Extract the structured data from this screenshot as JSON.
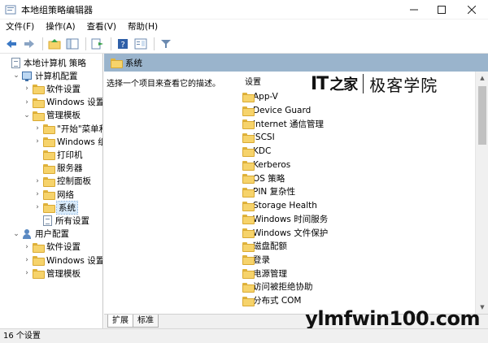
{
  "window": {
    "title": "本地组策略编辑器"
  },
  "menu": [
    "文件(F)",
    "操作(A)",
    "查看(V)",
    "帮助(H)"
  ],
  "tree": [
    {
      "label": "本地计算机 策略",
      "icon": "doc-icon",
      "arrow": "",
      "indent": 0
    },
    {
      "label": "计算机配置",
      "icon": "pc-icon",
      "arrow": "▼",
      "indent": 1
    },
    {
      "label": "软件设置",
      "icon": "folder-icon",
      "arrow": "›",
      "indent": 2
    },
    {
      "label": "Windows 设置",
      "icon": "folder-icon",
      "arrow": "›",
      "indent": 2
    },
    {
      "label": "管理模板",
      "icon": "folder-icon",
      "arrow": "▼",
      "indent": 2
    },
    {
      "label": "\"开始\"菜单和",
      "icon": "folder-icon",
      "arrow": "›",
      "indent": 3
    },
    {
      "label": "Windows 组件",
      "icon": "folder-icon",
      "arrow": "›",
      "indent": 3
    },
    {
      "label": "打印机",
      "icon": "folder-icon",
      "arrow": "",
      "indent": 3
    },
    {
      "label": "服务器",
      "icon": "folder-icon",
      "arrow": "",
      "indent": 3
    },
    {
      "label": "控制面板",
      "icon": "folder-icon",
      "arrow": "›",
      "indent": 3
    },
    {
      "label": "网络",
      "icon": "folder-icon",
      "arrow": "›",
      "indent": 3
    },
    {
      "label": "系统",
      "icon": "folder-icon",
      "arrow": "›",
      "indent": 3,
      "selected": true
    },
    {
      "label": "所有设置",
      "icon": "doc-icon",
      "arrow": "",
      "indent": 3
    },
    {
      "label": "用户配置",
      "icon": "user-icon",
      "arrow": "▼",
      "indent": 1
    },
    {
      "label": "软件设置",
      "icon": "folder-icon",
      "arrow": "›",
      "indent": 2
    },
    {
      "label": "Windows 设置",
      "icon": "folder-icon",
      "arrow": "›",
      "indent": 2
    },
    {
      "label": "管理模板",
      "icon": "folder-icon",
      "arrow": "›",
      "indent": 2
    }
  ],
  "pane": {
    "header": "系统",
    "description": "选择一个项目来查看它的描述。",
    "column_header": "设置"
  },
  "list": [
    "App-V",
    "Device Guard",
    "Internet 通信管理",
    "iSCSI",
    "KDC",
    "Kerberos",
    "OS 策略",
    "PIN 复杂性",
    "Storage Health",
    "Windows 时间服务",
    "Windows 文件保护",
    "磁盘配额",
    "登录",
    "电源管理",
    "访问被拒绝协助",
    "分布式 COM"
  ],
  "tabs": [
    "扩展",
    "标准"
  ],
  "status": "16 个设置",
  "logo": {
    "it": "IT",
    "chi": "之家",
    "cn": "极客学院"
  },
  "watermark": "ylmfwin100.com",
  "colors": {
    "header": "#9ab4cc",
    "folder": "#f6d36b",
    "selection": "#d9ebfb"
  }
}
